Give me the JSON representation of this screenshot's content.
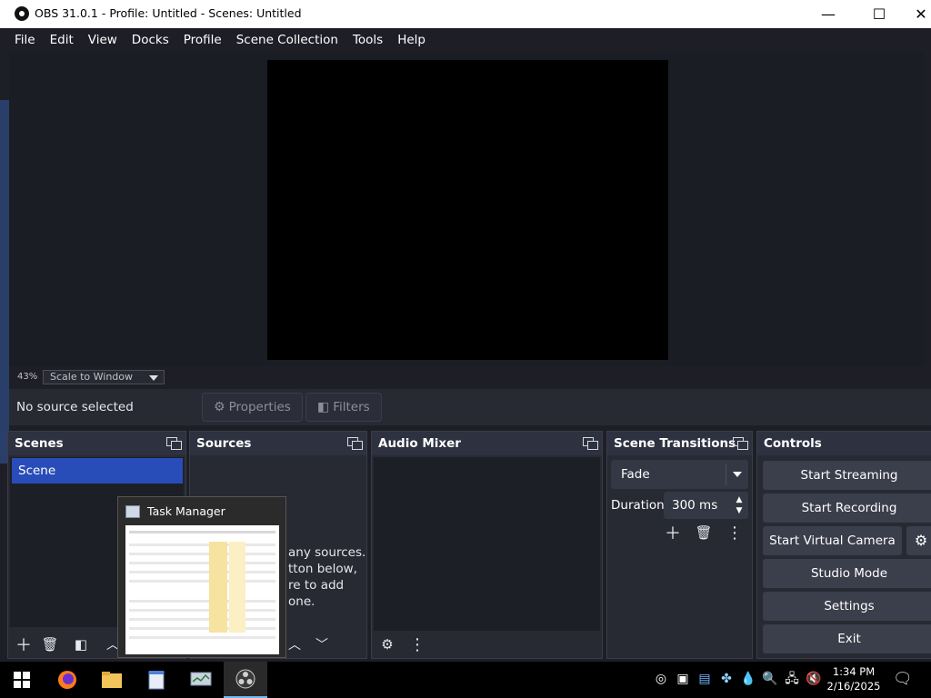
{
  "window": {
    "title": "OBS 31.0.1 - Profile: Untitled - Scenes: Untitled",
    "controls": {
      "minimize": "—",
      "maximize": "☐",
      "close": "✕"
    }
  },
  "menu": [
    "File",
    "Edit",
    "View",
    "Docks",
    "Profile",
    "Scene Collection",
    "Tools",
    "Help"
  ],
  "preview": {
    "zoom": "43%",
    "scale_mode": "Scale to Window"
  },
  "context_bar": {
    "status": "No source selected",
    "properties_label": "Properties",
    "filters_label": "Filters"
  },
  "docks": {
    "scenes": {
      "title": "Scenes",
      "items": [
        "Scene"
      ]
    },
    "sources": {
      "title": "Sources",
      "hint_lines": [
        "any sources.",
        "tton below,",
        "re to add one."
      ]
    },
    "audio_mixer": {
      "title": "Audio Mixer"
    },
    "scene_transitions": {
      "title": "Scene Transitions",
      "transition": "Fade",
      "duration_label": "Duration",
      "duration_value": "300 ms"
    },
    "controls": {
      "title": "Controls",
      "buttons": [
        "Start Streaming",
        "Start Recording",
        "Start Virtual Camera",
        "Studio Mode",
        "Settings",
        "Exit"
      ]
    }
  },
  "taskbar_popup": {
    "title": "Task Manager"
  },
  "taskbar": {
    "apps": [
      "start-icon",
      "firefox-icon",
      "file-explorer-icon",
      "notepad-icon",
      "task-manager-icon",
      "obs-icon"
    ],
    "clock_time": "1:34 PM",
    "clock_date": "2/16/2025"
  },
  "colors": {
    "accent_selected": "#284cb8",
    "panel_bg": "#272a33",
    "window_bg": "#1e1f26"
  }
}
